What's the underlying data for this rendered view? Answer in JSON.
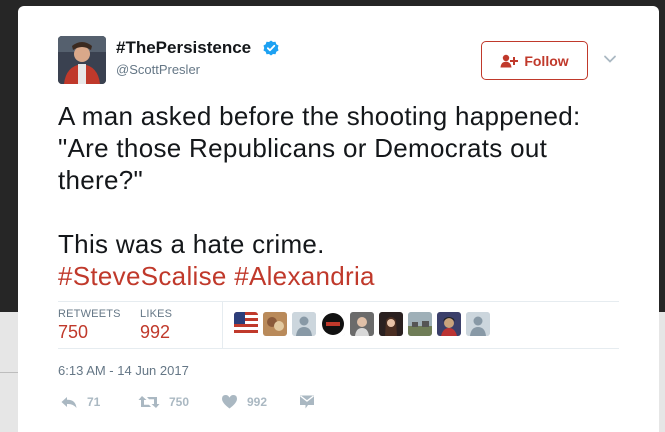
{
  "tweet": {
    "display_name": "#ThePersistence",
    "handle": "@ScottPresler",
    "follow_label": "Follow",
    "lines": [
      "A man asked before the shooting happened:",
      "\"Are those Republicans or Democrats out",
      "there?\""
    ],
    "second_paragraph": "This was a hate crime.",
    "hashtags": [
      "#SteveScalise",
      "#Alexandria"
    ],
    "timestamp": "6:13 AM - 14 Jun 2017"
  },
  "stats": {
    "retweets_label": "RETWEETS",
    "retweets": "750",
    "likes_label": "LIKES",
    "likes": "992"
  },
  "actions": {
    "reply_count": "71",
    "retweet_count": "750",
    "like_count": "992"
  },
  "colors": {
    "accent": "#c0392b",
    "muted": "#657786",
    "text": "#14171a",
    "verified": "#1da1f2"
  },
  "icons": [
    "verified-badge-icon",
    "follow-person-icon",
    "chevron-down-icon",
    "reply-icon",
    "retweet-icon",
    "heart-icon",
    "direct-message-icon"
  ]
}
